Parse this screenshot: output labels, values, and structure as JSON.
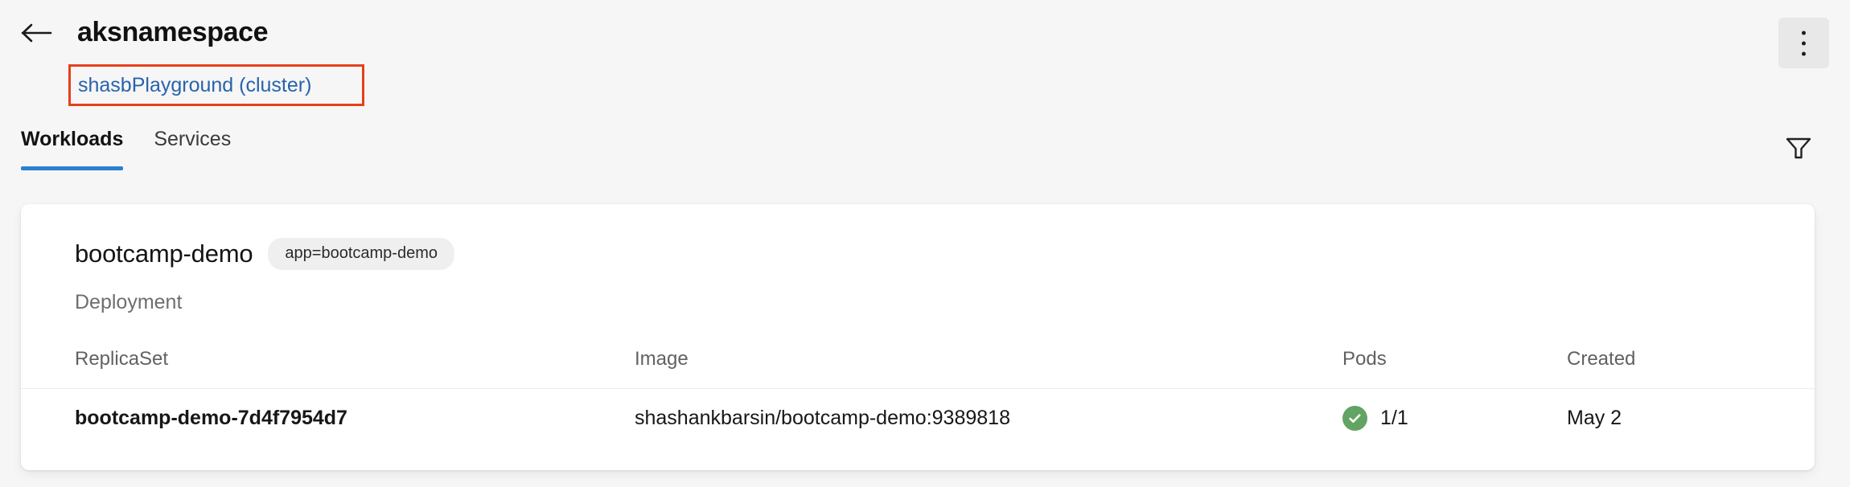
{
  "header": {
    "back_icon": "arrow-left-icon",
    "title": "aksnamespace",
    "cluster_link": "shasbPlayground (cluster)",
    "overflow_icon": "more-vertical-icon",
    "annotation_color": "#e5401c",
    "link_color": "#2863ac"
  },
  "tabbar": {
    "tabs": [
      {
        "label": "Workloads",
        "active": true
      },
      {
        "label": "Services",
        "active": false
      }
    ],
    "filter_icon": "funnel-filter-icon",
    "active_underline_color": "#2c7fd1"
  },
  "workload": {
    "name": "bootcamp-demo",
    "label_chip": "app=bootcamp-demo",
    "kind": "Deployment"
  },
  "table": {
    "columns": [
      "ReplicaSet",
      "Image",
      "Pods",
      "Created"
    ],
    "rows": [
      {
        "replicaset": "bootcamp-demo-7d4f7954d7",
        "image": "shashankbarsin/bootcamp-demo:9389818",
        "pods": "1/1",
        "pods_status_icon": "check-circle-icon",
        "pods_status_color": "#63a363",
        "created": "May 2"
      }
    ]
  }
}
